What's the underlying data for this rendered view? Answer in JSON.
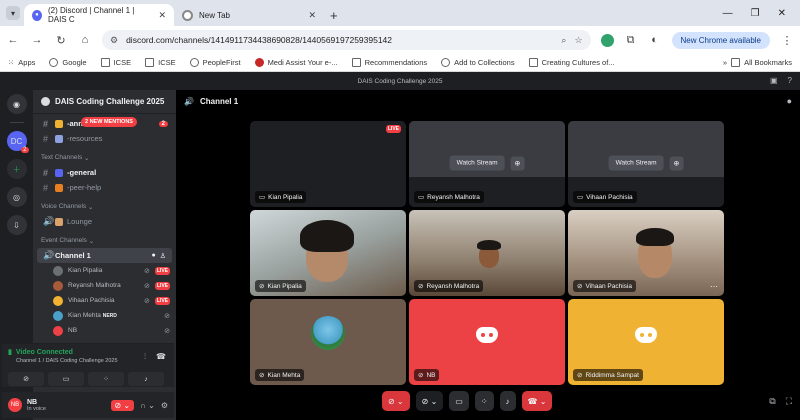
{
  "browser": {
    "tabs": [
      {
        "title": "(2) Discord | Channel 1 | DAIS C",
        "favicon": "discord-icon"
      },
      {
        "title": "New Tab",
        "favicon": "chrome-icon"
      }
    ],
    "url": "discord.com/channels/1414911734438690828/1440569197259395142",
    "chrome_available": "New Chrome available",
    "bookmarks": [
      "Apps",
      "Google",
      "ICSE",
      "ICSE",
      "PeopleFirst",
      "Medi Assist Your e-...",
      "Recommendations",
      "Add to Collections",
      "Creating Cultures of..."
    ],
    "all_bookmarks": "All Bookmarks"
  },
  "discord": {
    "window_title": "DAIS Coding Challenge 2025",
    "server_badge": "2",
    "server_abbrev": "DC",
    "guild_name": "DAIS Coding Challenge 2025",
    "mentions": "2 NEW MENTIONS",
    "channels_top": [
      {
        "name": "-ann",
        "count": "2"
      },
      {
        "name": "-resources"
      }
    ],
    "text_category": "Text Channels",
    "text_channels": [
      "-general",
      "-peer-help"
    ],
    "voice_category": "Voice Channels",
    "voice_channels": [
      "Lounge"
    ],
    "event_category": "Event Channels",
    "active_voice": "Channel 1",
    "voice_users": [
      {
        "name": "Kian Pipalia",
        "tag": "LIVE"
      },
      {
        "name": "Reyansh Malhotra",
        "tag": "LIVE"
      },
      {
        "name": "Vihaan Pachisia",
        "tag": "LIVE"
      },
      {
        "name": "Kian Mehta",
        "tag": "NERD"
      },
      {
        "name": "NB",
        "tag": ""
      }
    ],
    "voice_status": "Video Connected",
    "voice_sub": "Channel 1 / DAIS Coding Challenge 2025",
    "user": {
      "name": "NB",
      "status": "In voice",
      "avatar": "NB"
    },
    "stage_title": "Channel 1",
    "tiles": [
      {
        "name": "Kian Pipalia",
        "kind": "stream",
        "live": "LIVE"
      },
      {
        "name": "Reyansh Malhotra",
        "kind": "stream",
        "watch": "Watch Stream"
      },
      {
        "name": "Vihaan Pachisia",
        "kind": "stream",
        "watch": "Watch Stream"
      },
      {
        "name": "Kian Pipalia",
        "kind": "camera"
      },
      {
        "name": "Reyansh Malhotra",
        "kind": "camera"
      },
      {
        "name": "Vihaan Pachisia",
        "kind": "camera"
      },
      {
        "name": "Kian Mehta",
        "kind": "avatar"
      },
      {
        "name": "NB",
        "kind": "avatar-red"
      },
      {
        "name": "Riddimma Sampat",
        "kind": "avatar-orange"
      }
    ]
  }
}
